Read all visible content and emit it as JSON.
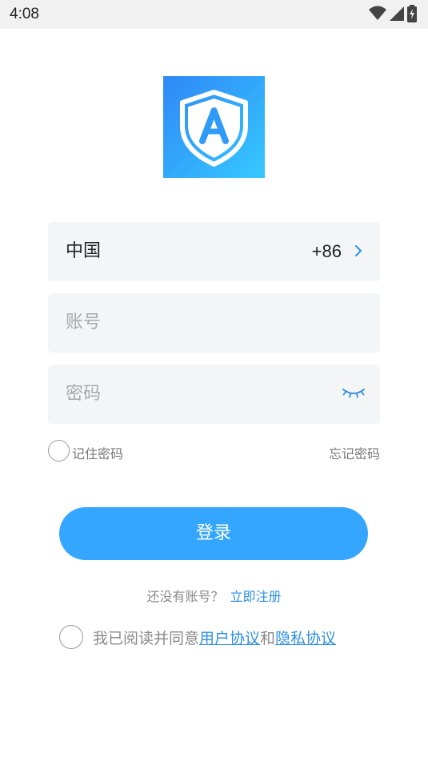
{
  "status_bar": {
    "time": "4:08"
  },
  "form": {
    "country_name": "中国",
    "country_code": "+86",
    "account_placeholder": "账号",
    "password_placeholder": "密码",
    "remember_label": "记住密码",
    "forgot_label": "忘记密码"
  },
  "login_button_label": "登录",
  "register": {
    "prompt": "还没有账号？",
    "link": "立即注册"
  },
  "agreement": {
    "prefix": "我已阅读并同意",
    "user_agreement": "用户协议",
    "and": "和",
    "privacy_policy": "隐私协议"
  },
  "colors": {
    "accent": "#35a6ff",
    "link": "#2e8fe6",
    "field_bg": "#f4f5f7"
  }
}
